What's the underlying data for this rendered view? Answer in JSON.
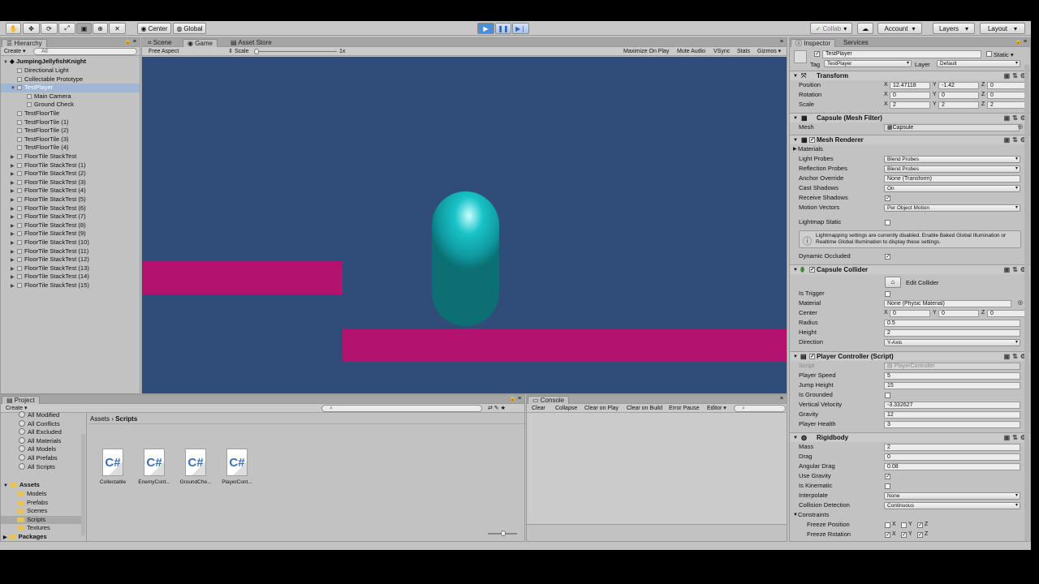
{
  "toolbar": {
    "pivot": "Center",
    "space": "Global",
    "collab": "Collab",
    "account": "Account",
    "layers": "Layers",
    "layout": "Layout"
  },
  "hierarchy": {
    "tab": "Hierarchy",
    "create": "Create",
    "search_placeholder": "All",
    "scene": "JumpingJellyfishKnight",
    "items": [
      {
        "label": "Directional Light",
        "indent": 1
      },
      {
        "label": "Collectable Prototype",
        "indent": 1
      },
      {
        "label": "TestPlayer",
        "indent": 1,
        "selected": true,
        "expanded": true
      },
      {
        "label": "Main Camera",
        "indent": 2
      },
      {
        "label": "Ground Check",
        "indent": 2
      },
      {
        "label": "TestFloorTile",
        "indent": 1
      },
      {
        "label": "TestFloorTile (1)",
        "indent": 1
      },
      {
        "label": "TestFloorTile (2)",
        "indent": 1
      },
      {
        "label": "TestFloorTile (3)",
        "indent": 1
      },
      {
        "label": "TestFloorTile (4)",
        "indent": 1
      },
      {
        "label": "FloorTile StackTest",
        "indent": 1,
        "fold": true
      },
      {
        "label": "FloorTile StackTest (1)",
        "indent": 1,
        "fold": true
      },
      {
        "label": "FloorTile StackTest (2)",
        "indent": 1,
        "fold": true
      },
      {
        "label": "FloorTile StackTest (3)",
        "indent": 1,
        "fold": true
      },
      {
        "label": "FloorTile StackTest (4)",
        "indent": 1,
        "fold": true
      },
      {
        "label": "FloorTile StackTest (5)",
        "indent": 1,
        "fold": true
      },
      {
        "label": "FloorTile StackTest (6)",
        "indent": 1,
        "fold": true
      },
      {
        "label": "FloorTile StackTest (7)",
        "indent": 1,
        "fold": true
      },
      {
        "label": "FloorTile StackTest (8)",
        "indent": 1,
        "fold": true
      },
      {
        "label": "FloorTile StackTest (9)",
        "indent": 1,
        "fold": true
      },
      {
        "label": "FloorTile StackTest (10)",
        "indent": 1,
        "fold": true
      },
      {
        "label": "FloorTile StackTest (11)",
        "indent": 1,
        "fold": true
      },
      {
        "label": "FloorTile StackTest (12)",
        "indent": 1,
        "fold": true
      },
      {
        "label": "FloorTile StackTest (13)",
        "indent": 1,
        "fold": true
      },
      {
        "label": "FloorTile StackTest (14)",
        "indent": 1,
        "fold": true
      },
      {
        "label": "FloorTile StackTest (15)",
        "indent": 1,
        "fold": true
      }
    ]
  },
  "game": {
    "tabs": [
      "Scene",
      "Game",
      "Asset Store"
    ],
    "active_tab": "Game",
    "aspect": "Free Aspect",
    "scale_label": "Scale",
    "scale_value": "1x",
    "options": [
      "Maximize On Play",
      "Mute Audio",
      "VSync",
      "Stats",
      "Gizmos"
    ],
    "bg_color": "#2f4d78",
    "platform_color": "#b3126e",
    "capsule_color": "#18c3c8"
  },
  "inspector": {
    "tabs": [
      "Inspector",
      "Services"
    ],
    "object_name": "TestPlayer",
    "static_label": "Static",
    "tag_label": "Tag",
    "tag_value": "TestPlayer",
    "layer_label": "Layer",
    "layer_value": "Default",
    "transform": {
      "title": "Transform",
      "position": {
        "label": "Position",
        "x": "12.47118",
        "y": "-1.42",
        "z": "0"
      },
      "rotation": {
        "label": "Rotation",
        "x": "0",
        "y": "0",
        "z": "0"
      },
      "scale": {
        "label": "Scale",
        "x": "2",
        "y": "2",
        "z": "2"
      }
    },
    "mesh_filter": {
      "title": "Capsule (Mesh Filter)",
      "mesh_label": "Mesh",
      "mesh_value": "Capsule"
    },
    "mesh_renderer": {
      "title": "Mesh Renderer",
      "materials": "Materials",
      "light_probes": {
        "label": "Light Probes",
        "value": "Blend Probes"
      },
      "reflection_probes": {
        "label": "Reflection Probes",
        "value": "Blend Probes"
      },
      "anchor_override": {
        "label": "Anchor Override",
        "value": "None (Transform)"
      },
      "cast_shadows": {
        "label": "Cast Shadows",
        "value": "On"
      },
      "receive_shadows": {
        "label": "Receive Shadows",
        "checked": true
      },
      "motion_vectors": {
        "label": "Motion Vectors",
        "value": "Per Object Motion"
      },
      "lightmap_static": {
        "label": "Lightmap Static",
        "checked": false
      },
      "info": "Lightmapping settings are currently disabled. Enable Baked Global Illumination or Realtime Global Illumination to display these settings.",
      "dynamic_occluded": {
        "label": "Dynamic Occluded",
        "checked": true
      }
    },
    "capsule_collider": {
      "title": "Capsule Collider",
      "edit_collider": "Edit Collider",
      "is_trigger": {
        "label": "Is Trigger",
        "checked": false
      },
      "material": {
        "label": "Material",
        "value": "None (Physic Material)"
      },
      "center": {
        "label": "Center",
        "x": "0",
        "y": "0",
        "z": "0"
      },
      "radius": {
        "label": "Radius",
        "value": "0.5"
      },
      "height": {
        "label": "Height",
        "value": "2"
      },
      "direction": {
        "label": "Direction",
        "value": "Y-Axis"
      }
    },
    "player_controller": {
      "title": "Player Controller (Script)",
      "script": {
        "label": "Script",
        "value": "PlayerController"
      },
      "player_speed": {
        "label": "Player Speed",
        "value": "5"
      },
      "jump_height": {
        "label": "Jump Height",
        "value": "15"
      },
      "is_grounded": {
        "label": "Is Grounded",
        "checked": false
      },
      "vertical_velocity": {
        "label": "Vertical Velocity",
        "value": "-3.332627"
      },
      "gravity": {
        "label": "Gravity",
        "value": "12"
      },
      "player_health": {
        "label": "Player Health",
        "value": "3"
      }
    },
    "rigidbody": {
      "title": "Rigidbody",
      "mass": {
        "label": "Mass",
        "value": "2"
      },
      "drag": {
        "label": "Drag",
        "value": "0"
      },
      "angular_drag": {
        "label": "Angular Drag",
        "value": "0.08"
      },
      "use_gravity": {
        "label": "Use Gravity",
        "checked": true
      },
      "is_kinematic": {
        "label": "Is Kinematic",
        "checked": false
      },
      "interpolate": {
        "label": "Interpolate",
        "value": "None"
      },
      "collision_detection": {
        "label": "Collision Detection",
        "value": "Continuous"
      },
      "constraints": "Constraints",
      "freeze_position": {
        "label": "Freeze Position",
        "x": false,
        "y": false,
        "z": true
      },
      "freeze_rotation": {
        "label": "Freeze Rotation",
        "x": true,
        "y": true,
        "z": true
      }
    }
  },
  "project": {
    "tab": "Project",
    "create": "Create",
    "favorites": [
      "All Modified",
      "All Conflicts",
      "All Excluded",
      "All Materials",
      "All Models",
      "All Prefabs",
      "All Scripts"
    ],
    "assets_root": "Assets",
    "folders": [
      "Models",
      "Prefabs",
      "Scenes",
      "Scripts",
      "Textures"
    ],
    "packages": "Packages",
    "breadcrumb": [
      "Assets",
      "Scripts"
    ],
    "files": [
      {
        "icon": "C#",
        "name": "Collectable"
      },
      {
        "icon": "C#",
        "name": "EnemyCont..."
      },
      {
        "icon": "C#",
        "name": "GroundChe..."
      },
      {
        "icon": "C#",
        "name": "PlayerCont..."
      }
    ]
  },
  "console": {
    "tab": "Console",
    "buttons": [
      "Clear",
      "Collapse",
      "Clear on Play",
      "Clear on Build",
      "Error Pause",
      "Editor"
    ]
  }
}
